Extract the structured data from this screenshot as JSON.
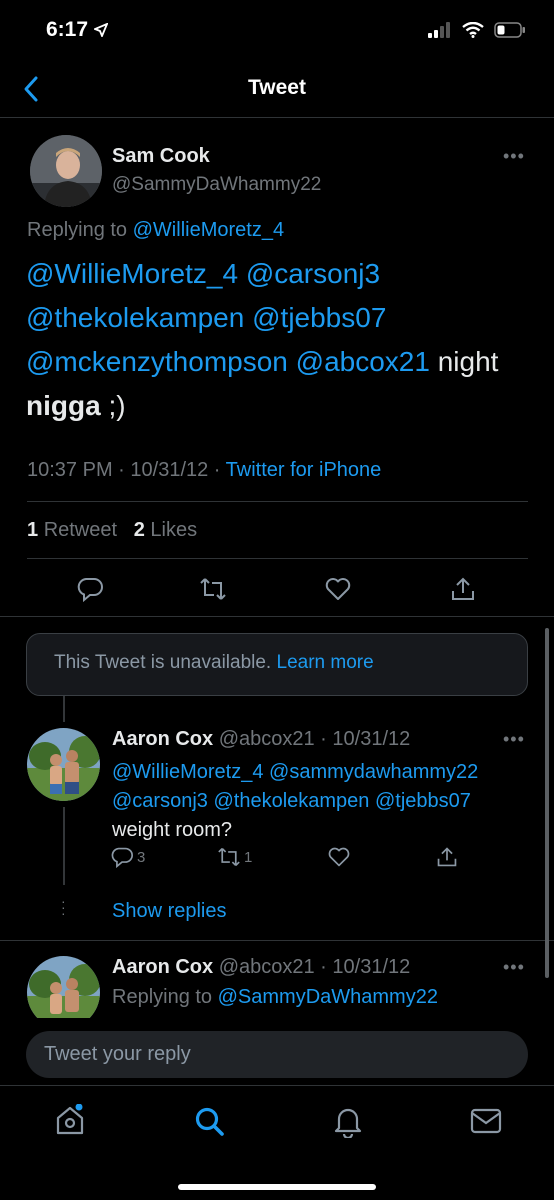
{
  "status": {
    "time": "6:17"
  },
  "header": {
    "title": "Tweet"
  },
  "tweet": {
    "name": "Sam Cook",
    "handle": "@SammyDaWhammy22",
    "replying_prefix": "Replying to ",
    "replying_to": "@WillieMoretz_4",
    "mentions_line1": [
      "@WillieMoretz_4",
      "@carsonj3"
    ],
    "mentions_line2": [
      "@thekolekampen",
      "@tjebbs07"
    ],
    "mentions_line3": [
      "@mckenzythompson",
      "@abcox21"
    ],
    "text_tail": " night",
    "text_bold": "nigga",
    "text_end": " ;)",
    "time": "10:37 PM",
    "date": "10/31/12",
    "source": "Twitter for iPhone",
    "retweet_count": "1",
    "retweet_label": "Retweet",
    "like_count": "2",
    "like_label": "Likes"
  },
  "unavailable": {
    "text": "This Tweet is unavailable.",
    "link": "Learn more"
  },
  "reply1": {
    "name": "Aaron Cox",
    "handle": "@abcox21",
    "date": "10/31/12",
    "mentions_line1": [
      "@WillieMoretz_4",
      "@sammydawhammy22"
    ],
    "mentions_line2": [
      "@carsonj3",
      "@thekolekampen",
      "@tjebbs07"
    ],
    "text": "weight room?",
    "reply_count": "3",
    "retweet_count": "1",
    "show_replies": "Show replies"
  },
  "reply2": {
    "name": "Aaron Cox",
    "handle": "@abcox21",
    "date": "10/31/12",
    "replying_prefix": "Replying to ",
    "replying_to": "@SammyDaWhammy22"
  },
  "composer": {
    "placeholder": "Tweet your reply"
  },
  "nav": {
    "items": [
      "home-icon",
      "search-icon",
      "notifications-icon",
      "messages-icon"
    ]
  },
  "colors": {
    "accent": "#1d9bf0",
    "background": "#000000",
    "secondary_text": "#71767b"
  }
}
